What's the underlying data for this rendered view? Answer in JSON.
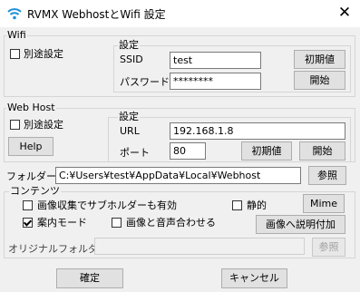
{
  "window": {
    "title": "RVMX WebhostとWifi 設定",
    "close_glyph": "✕"
  },
  "wifi": {
    "legend": "Wifi",
    "separate_label": "別途設定",
    "separate_checked": false,
    "settings_legend": "設定",
    "ssid_label": "SSID",
    "ssid_value": "test",
    "password_label": "パスワード",
    "password_value": "********",
    "reset_label": "初期値",
    "start_label": "開始"
  },
  "webhost": {
    "legend": "Web Host",
    "separate_label": "別途設定",
    "separate_checked": false,
    "help_label": "Help",
    "settings_legend": "設定",
    "url_label": "URL",
    "url_value": "192.168.1.8",
    "port_label": "ポート",
    "port_value": "80",
    "reset_label": "初期値",
    "start_label": "開始"
  },
  "folder": {
    "label": "フォルダー",
    "value": "C:¥Users¥test¥AppData¥Local¥Webhost",
    "browse_label": "参照"
  },
  "contents": {
    "legend": "コンテンツ",
    "sub_holder_label": "画像収集でサブホルダーも有効",
    "sub_holder_checked": false,
    "static_label": "静的",
    "static_checked": false,
    "mime_label": "Mime",
    "guide_mode_label": "案内モード",
    "guide_mode_checked": true,
    "image_audio_label": "画像と音声合わせる",
    "image_audio_checked": false,
    "add_description_label": "画像へ説明付加",
    "original_folder_label": "オリジナルフォルダー",
    "original_folder_value": "",
    "original_browse_label": "参照"
  },
  "footer": {
    "ok_label": "確定",
    "cancel_label": "キャンセル"
  }
}
